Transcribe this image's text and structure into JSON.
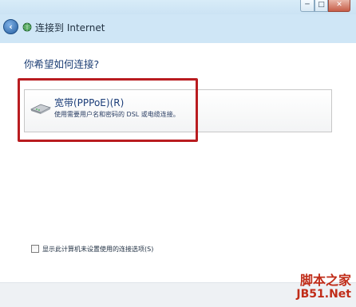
{
  "window": {
    "title": "连接到 Internet",
    "controls": {
      "minimize": "─",
      "maximize": "□",
      "close": "✕"
    }
  },
  "main": {
    "question": "你希望如何连接?",
    "option": {
      "title": "宽带(PPPoE)(R)",
      "description": "使用需要用户名和密码的 DSL 或电缆连接。"
    },
    "checkbox_label": "显示此计算机未设置使用的连接选项(S)"
  },
  "watermark": {
    "line1": "脚本之家",
    "line2": "JB51.Net"
  },
  "colors": {
    "highlight": "#b91c20",
    "title_text": "#1a3c78"
  }
}
